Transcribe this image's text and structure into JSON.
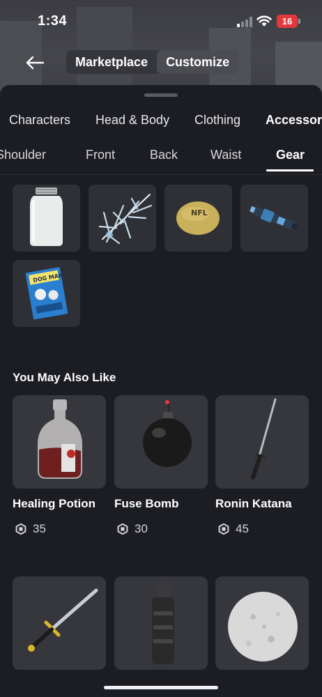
{
  "status_bar": {
    "time": "1:34",
    "battery": "16"
  },
  "header": {
    "back_icon": "arrow-left-icon",
    "tabs": [
      {
        "label": "Marketplace",
        "active": false
      },
      {
        "label": "Customize",
        "active": true
      }
    ]
  },
  "category_tabs": [
    "Characters",
    "Head & Body",
    "Clothing",
    "Accessories"
  ],
  "sub_tabs": [
    {
      "label": "Shoulder",
      "active": false
    },
    {
      "label": "Front",
      "active": false
    },
    {
      "label": "Back",
      "active": false
    },
    {
      "label": "Waist",
      "active": false
    },
    {
      "label": "Gear",
      "active": true
    }
  ],
  "owned_items": [
    {
      "icon": "glass-jar-icon"
    },
    {
      "icon": "ice-crystal-icon"
    },
    {
      "icon": "football-icon"
    },
    {
      "icon": "blaster-icon"
    },
    {
      "icon": "book-icon"
    }
  ],
  "recommendations": {
    "title": "You May Also Like",
    "currency_icon": "robux-icon",
    "items": [
      {
        "name": "Healing Potion",
        "price": "35",
        "icon": "potion-icon"
      },
      {
        "name": "Fuse Bomb",
        "price": "30",
        "icon": "bomb-icon"
      },
      {
        "name": "Ronin Katana",
        "price": "45",
        "icon": "katana-icon"
      },
      {
        "name": "",
        "price": "",
        "icon": "sword-icon"
      },
      {
        "name": "",
        "price": "",
        "icon": "rocket-launcher-icon"
      },
      {
        "name": "",
        "price": "",
        "icon": "stone-ball-icon"
      }
    ]
  },
  "colors": {
    "background": "#1c1d22",
    "tile": "#2f3035",
    "accent": "#ffffff",
    "battery": "#e5383b"
  }
}
